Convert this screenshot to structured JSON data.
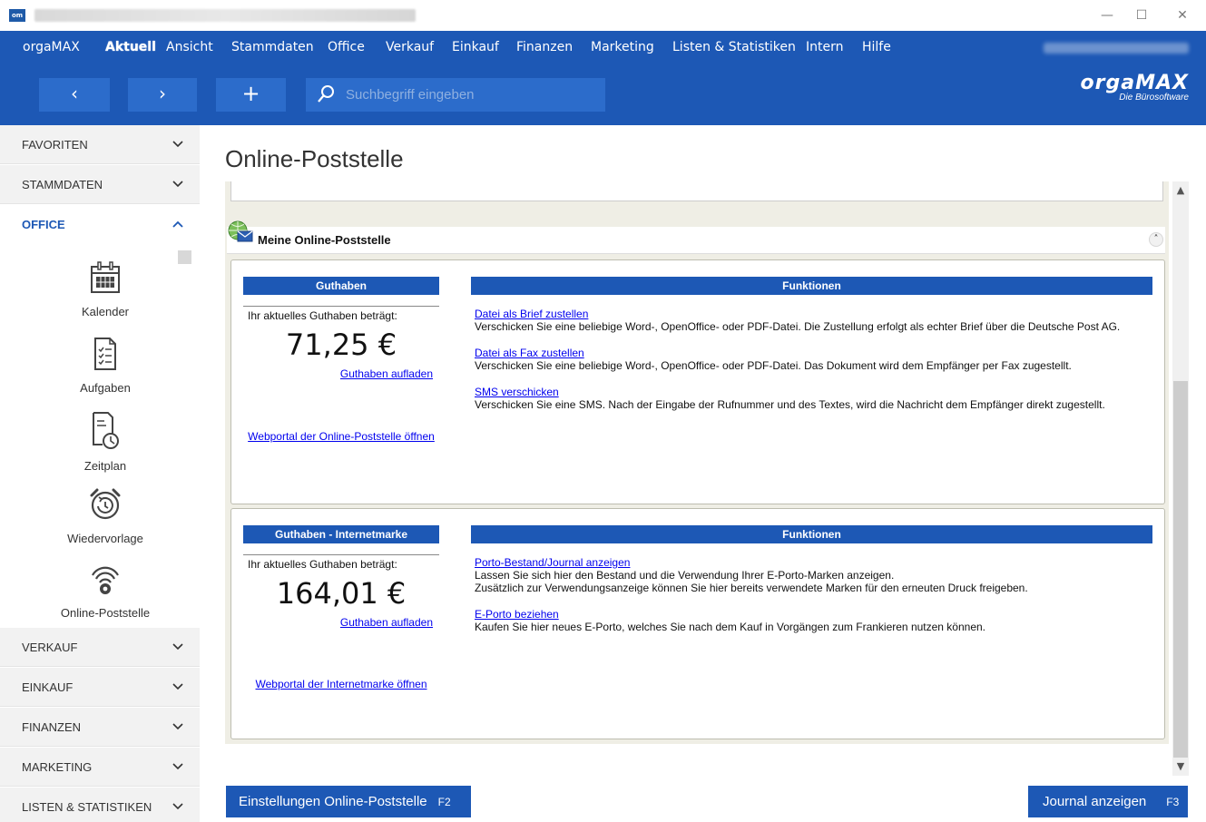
{
  "window": {
    "min_label": "—",
    "max_label": "☐",
    "close_label": "✕"
  },
  "menu": [
    {
      "label": "orgaMAX"
    },
    {
      "label": "Aktuell"
    },
    {
      "label": "Ansicht"
    },
    {
      "label": "Stammdaten"
    },
    {
      "label": "Office"
    },
    {
      "label": "Verkauf"
    },
    {
      "label": "Einkauf"
    },
    {
      "label": "Finanzen"
    },
    {
      "label": "Marketing"
    },
    {
      "label": "Listen & Statistiken"
    },
    {
      "label": "Intern"
    },
    {
      "label": "Hilfe"
    }
  ],
  "toolbar": {
    "back_label": "‹",
    "forward_label": "›",
    "add_label": "+",
    "search_placeholder": "Suchbegriff eingeben"
  },
  "brand": {
    "name": "orgaMAX",
    "tagline": "Die Bürosoftware"
  },
  "sidebar": {
    "sections": [
      {
        "label": "FAVORITEN"
      },
      {
        "label": "STAMMDATEN"
      },
      {
        "label": "OFFICE"
      },
      {
        "label": "VERKAUF"
      },
      {
        "label": "EINKAUF"
      },
      {
        "label": "FINANZEN"
      },
      {
        "label": "MARKETING"
      },
      {
        "label": "LISTEN & STATISTIKEN"
      }
    ],
    "office_items": [
      {
        "label": "Kalender",
        "icon": "calendar-icon"
      },
      {
        "label": "Aufgaben",
        "icon": "task-list-icon"
      },
      {
        "label": "Zeitplan",
        "icon": "schedule-icon"
      },
      {
        "label": "Wiedervorlage",
        "icon": "alarm-clock-icon"
      },
      {
        "label": "Online-Poststelle",
        "icon": "wireless-post-icon"
      }
    ]
  },
  "page": {
    "title": "Online-Poststelle",
    "panel_title": "Meine Online-Poststelle",
    "collapse_label": "˄"
  },
  "card_post": {
    "balance_header": "Guthaben",
    "functions_header": "Funktionen",
    "balance_label": "Ihr aktuelles Guthaben beträgt:",
    "balance_amount": "71,25 €",
    "topup_link": "Guthaben aufladen",
    "portal_link": "Webportal der Online-Poststelle öffnen",
    "functions": [
      {
        "link": "Datei als Brief zustellen",
        "text": "Verschicken Sie eine beliebige Word-, OpenOffice- oder PDF-Datei. Die Zustellung erfolgt als echter Brief über die Deutsche Post AG."
      },
      {
        "link": "Datei als Fax zustellen",
        "text": "Verschicken Sie eine beliebige Word-, OpenOffice- oder PDF-Datei. Das Dokument wird dem Empfänger per Fax zugestellt."
      },
      {
        "link": "SMS verschicken",
        "text": "Verschicken Sie eine SMS. Nach der Eingabe der Rufnummer und des Textes, wird die Nachricht dem Empfänger direkt zugestellt."
      }
    ]
  },
  "card_stamp": {
    "balance_header": "Guthaben - Internetmarke",
    "functions_header": "Funktionen",
    "balance_label": "Ihr aktuelles Guthaben beträgt:",
    "balance_amount": "164,01 €",
    "topup_link": "Guthaben aufladen",
    "portal_link": "Webportal der Internetmarke öffnen",
    "functions": [
      {
        "link": "Porto-Bestand/Journal anzeigen",
        "text": "Lassen Sie sich hier den Bestand und die Verwendung Ihrer E-Porto-Marken anzeigen.",
        "text2": "Zusätzlich zur Verwendungsanzeige können Sie hier bereits verwendete Marken für den erneuten Druck freigeben."
      },
      {
        "link": "E-Porto beziehen",
        "text": "Kaufen Sie hier neues E-Porto, welches Sie nach dem Kauf in Vorgängen zum Frankieren nutzen können."
      }
    ]
  },
  "bottom": {
    "settings_label": "Einstellungen Online-Poststelle",
    "settings_key": "F2",
    "journal_label": "Journal anzeigen",
    "journal_key": "F3"
  },
  "colors": {
    "brand_blue": "#1d58b5",
    "button_blue": "#2c6ccb",
    "link_blue": "#0000ee",
    "content_bg": "#efeee5"
  }
}
